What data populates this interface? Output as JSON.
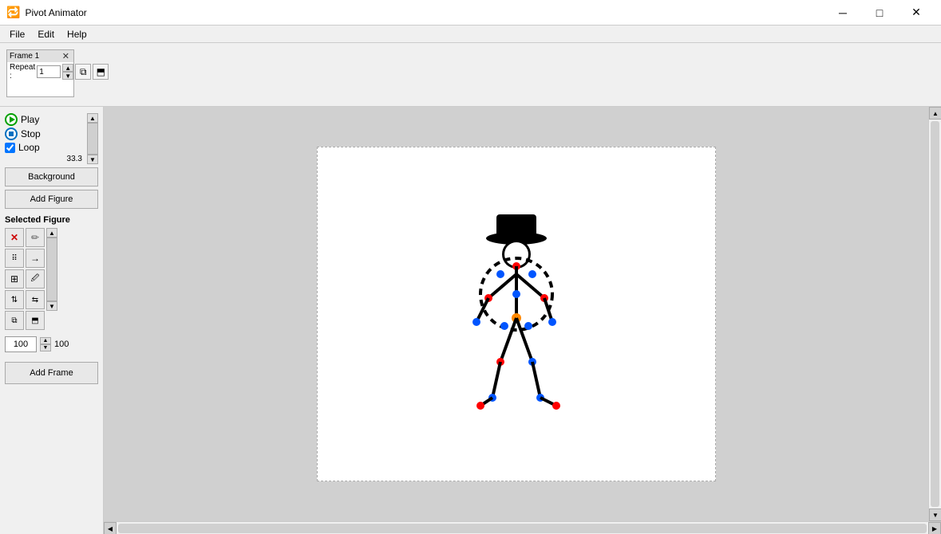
{
  "titlebar": {
    "icon": "🔁",
    "title": "Pivot Animator",
    "btn_minimize": "─",
    "btn_maximize": "□",
    "btn_close": "✕"
  },
  "menubar": {
    "items": [
      "File",
      "Edit",
      "Help"
    ]
  },
  "frame_strip": {
    "frame_label": "Frame 1",
    "repeat_label": "Repeat :",
    "repeat_value": "1"
  },
  "left_panel": {
    "play_label": "Play",
    "stop_label": "Stop",
    "loop_label": "Loop",
    "fps_value": "33.3",
    "background_btn": "Background",
    "add_figure_btn": "Add Figure",
    "selected_figure_label": "Selected Figure",
    "size_value": "100",
    "size_max": "100",
    "add_frame_btn": "Add Frame"
  },
  "icons": {
    "delete": "✕",
    "pencil": "✏",
    "multi_copy": "⠿",
    "arrow": "→",
    "grid": "⊞",
    "eyedrop": "✦",
    "copy_vert": "⧉",
    "copy_horiz": "⧉",
    "copy2": "⧉",
    "paste": "⬒",
    "scroll_up": "▲",
    "scroll_down": "▼",
    "scroll_up2": "▲",
    "scroll_down2": "▼"
  }
}
